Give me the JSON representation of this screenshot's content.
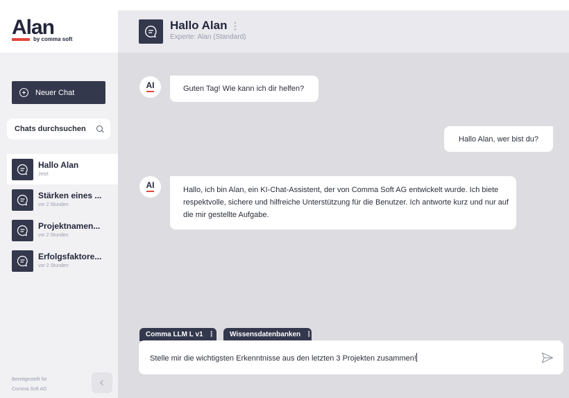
{
  "sidebar": {
    "logo": {
      "name": "Alan",
      "sub": "by comma soft"
    },
    "new_chat_label": "Neuer Chat",
    "search_label": "Chats durchsuchen",
    "chats": [
      {
        "title": "Hallo Alan",
        "time": "Jetzt"
      },
      {
        "title": "Stärken eines ...",
        "time": "vor 2 Stunden"
      },
      {
        "title": "Projektnamen...",
        "time": "vor 2 Stunden"
      },
      {
        "title": "Erfolgsfaktore...",
        "time": "vor 2 Stunden"
      }
    ],
    "footer": {
      "line1": "Bereitgestellt für",
      "line2": "Comma Soft AG"
    }
  },
  "header": {
    "title": "Hallo Alan",
    "subtitle": "Experte: Alan (Standard)"
  },
  "messages": [
    {
      "role": "assistant",
      "avatar": "AI",
      "text": "Guten Tag! Wie kann ich dir helfen?"
    },
    {
      "role": "user",
      "text": "Hallo Alan, wer bist du?"
    },
    {
      "role": "assistant",
      "avatar": "AI",
      "lines": [
        "Hallo, ich bin Alan, ein KI-Chat-Assistent, der von Comma Soft AG entwickelt wurde. Ich biete",
        "respektvolle, sichere und hilfreiche Unterstützung für die Benutzer. Ich antworte kurz und nur auf",
        "die mir gestellte Aufgabe."
      ]
    }
  ],
  "composer": {
    "model_tab": "Comma LLM L v1",
    "knowledge_tab": "Wissensdatenbanken",
    "input_value": "Stelle mir die wichtigsten Erkenntnisse aus den letzten 3 Projekten zusammen!"
  },
  "colors": {
    "accent": "#e4453a",
    "dark": "#34384d",
    "sidebar_bg": "#f1f1f4",
    "conversation_bg": "#dcdce1"
  },
  "icons": [
    "plus-circle-icon",
    "search-icon",
    "chat-bubble-icon",
    "more-vertical-icon",
    "chevron-left-icon",
    "send-icon"
  ]
}
